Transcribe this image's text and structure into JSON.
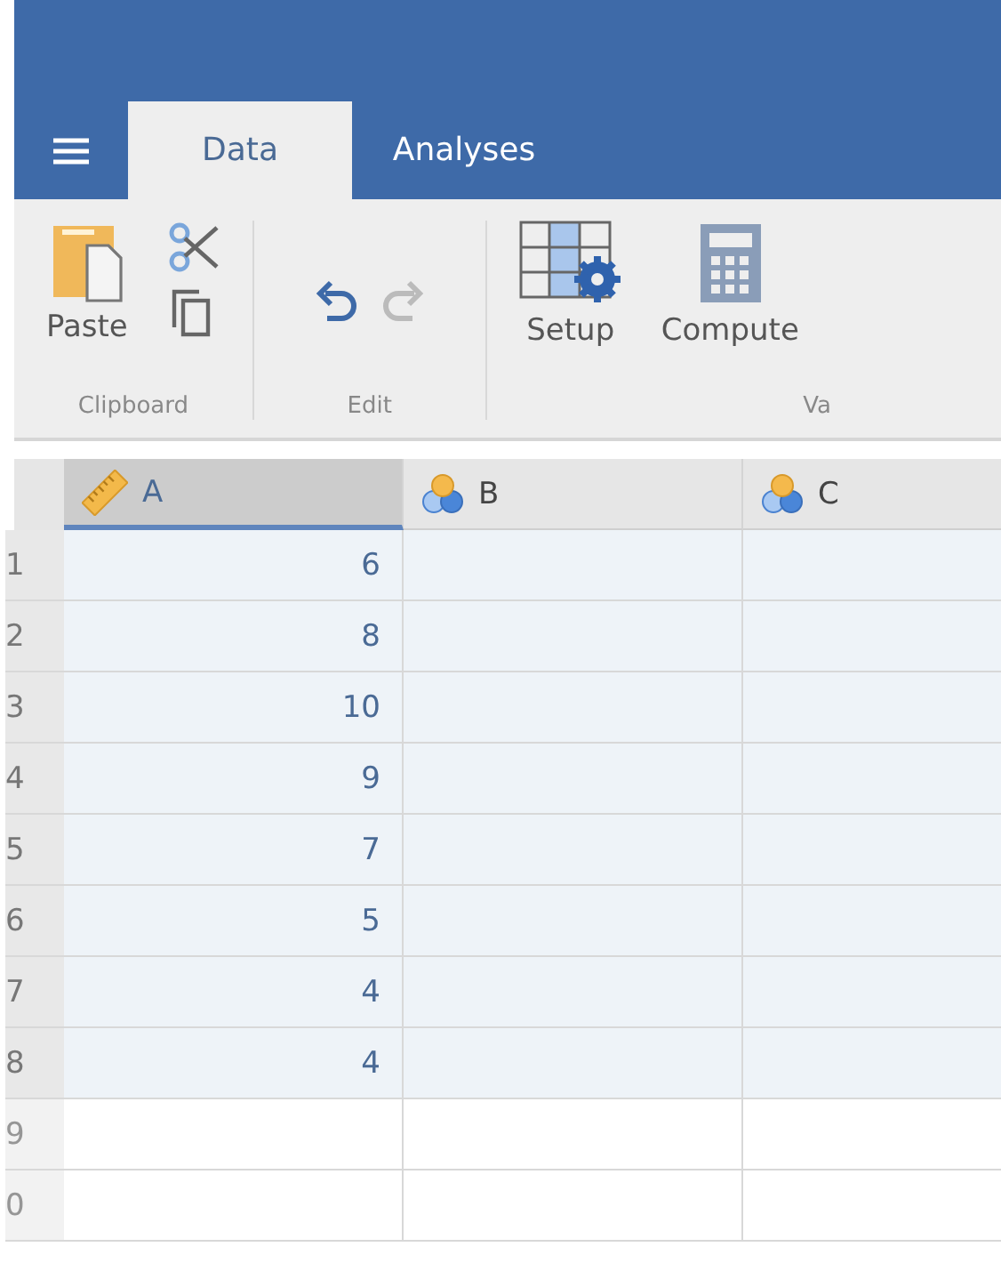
{
  "tabs": [
    {
      "label": "Data",
      "selected": true
    },
    {
      "label": "Analyses",
      "selected": false
    }
  ],
  "ribbon": [
    {
      "label": "Clipboard",
      "tools": [
        {
          "kind": "paste",
          "label": "Paste"
        },
        {
          "kind": "cut"
        },
        {
          "kind": "copy"
        }
      ]
    },
    {
      "label": "Edit",
      "tools": [
        {
          "kind": "undo",
          "disabled": false
        },
        {
          "kind": "redo",
          "disabled": true
        }
      ]
    },
    {
      "label": "Va",
      "tools": [
        {
          "kind": "setup",
          "label": "Setup"
        },
        {
          "kind": "compute",
          "label": "Compute"
        }
      ]
    }
  ],
  "columns": [
    {
      "name": "A",
      "kind": "continuous",
      "selected": true
    },
    {
      "name": "B",
      "kind": "nominal",
      "selected": false
    },
    {
      "name": "C",
      "kind": "nominal",
      "selected": false
    }
  ],
  "rows": [
    {
      "number": "1",
      "cells": [
        "6"
      ]
    },
    {
      "number": "2",
      "cells": [
        "8"
      ]
    },
    {
      "number": "3",
      "cells": [
        "10"
      ]
    },
    {
      "number": "4",
      "cells": [
        "9"
      ]
    },
    {
      "number": "5",
      "cells": [
        "7"
      ]
    },
    {
      "number": "6",
      "cells": [
        "5"
      ]
    },
    {
      "number": "7",
      "cells": [
        "4"
      ]
    },
    {
      "number": "8",
      "cells": [
        "4"
      ]
    },
    {
      "number": "9",
      "cells": []
    },
    {
      "number": "0",
      "cells": []
    }
  ]
}
